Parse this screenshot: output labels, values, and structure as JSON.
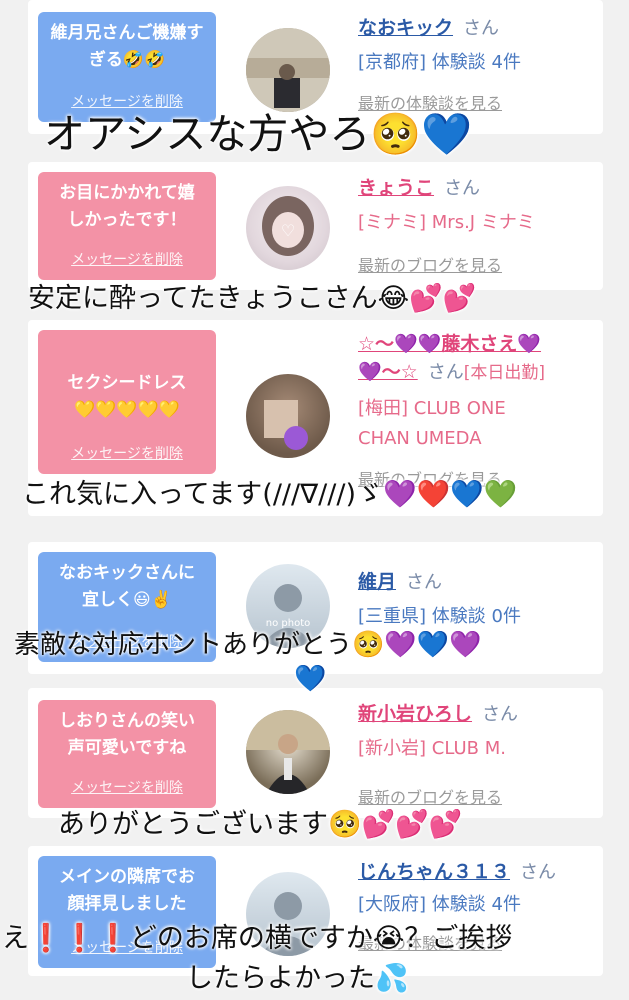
{
  "cards": [
    {
      "message": "維月兄さんご機嫌すぎる🤣🤣",
      "delete_label": "メッセージを削除",
      "name": "なおキック",
      "honorific": "さん",
      "meta1": "[京都府] 体験談 4件",
      "link": "最新の体験談を見る"
    },
    {
      "message": "お目にかかれて嬉しかったです！",
      "delete_label": "メッセージを削除",
      "name": "きょうこ",
      "honorific": "さん",
      "meta1": "[ミナミ] Mrs.J ミナミ",
      "link": "最新のブログを見る"
    },
    {
      "message": "セクシードレス💛💛💛💛💛",
      "delete_label": "メッセージを削除",
      "name": "☆〜💜💜藤木さえ💜",
      "name2": "💜〜☆",
      "honorific": "さん",
      "status": "[本日出勤]",
      "meta1": "[梅田] CLUB ONE",
      "meta2": "CHAN UMEDA",
      "link": "最新のブログを見る"
    },
    {
      "message": "なおキックさんに宜しく😃✌️",
      "delete_label": "メッセージを削除",
      "name": "維月",
      "honorific": "さん",
      "meta1": "[三重県] 体験談 0件",
      "link": "最新の体験談を見る",
      "avatar_text": "no photo"
    },
    {
      "message": "しおりさんの笑い声可愛いですね",
      "delete_label": "メッセージを削除",
      "name": "新小岩ひろし",
      "honorific": "さん",
      "meta1": "[新小岩] CLUB M.",
      "link": "最新のブログを見る"
    },
    {
      "message": "メインの隣席でお顔拝見しました",
      "delete_label": "メッセージを削除",
      "name": "じんちゃん３１３",
      "honorific": "さん",
      "meta1": "[大阪府] 体験談 4件",
      "link": "最新の体験談を見る"
    }
  ],
  "overlays": [
    "オアシスな方やろ🥺💙",
    "安定に酔ってたきょうこさん😂💕💕",
    "これ気に入ってます(///∇///)ゞ💜❤️💙💚",
    "素敵な対応ホントありがとう🥺💜💙💜",
    "💙",
    "ありがとうございます🥺💕💕💕",
    "え❗️❗️❗️どのお席の横ですか😭？ご挨拶",
    "したらよかった💦"
  ],
  "colors": {
    "blue_bubble": "#7aaaf0",
    "pink_bubble": "#f392a6",
    "blue_name": "#2b5aa6",
    "pink_name": "#e0457a"
  }
}
